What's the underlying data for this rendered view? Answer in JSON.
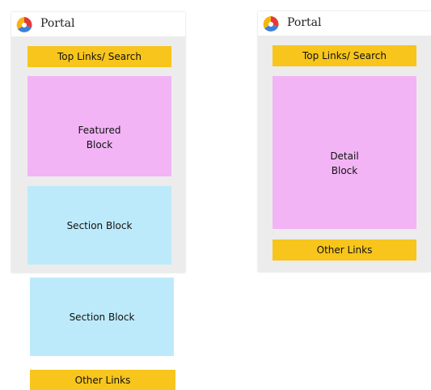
{
  "left": {
    "brand": "Portal",
    "top_links": "Top Links/ Search",
    "featured": [
      "Featured",
      "Block"
    ],
    "section1": "Section Block",
    "section2": "Section Block",
    "other_links": "Other Links"
  },
  "right": {
    "brand": "Portal",
    "top_links": "Top Links/ Search",
    "detail": [
      "Detail",
      "Block"
    ],
    "other_links": "Other Links"
  },
  "colors": {
    "yellow": "#f7c51c",
    "pink": "#f2b4f5",
    "blue": "#bdeafa",
    "frame": "#ececec"
  },
  "icons": [
    "portal-logo-icon"
  ]
}
